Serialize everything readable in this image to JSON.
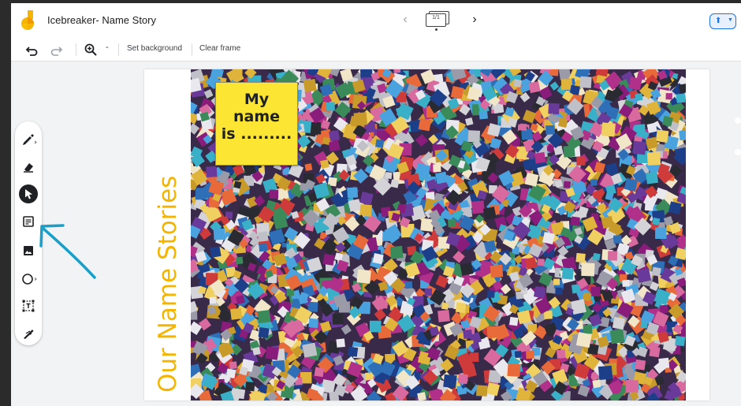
{
  "header": {
    "title": "Icebreaker- Name Story",
    "frame_counter": "1/1",
    "prev_icon": "chevron-left-icon",
    "next_icon": "chevron-right-icon",
    "share_icon": "present-icon"
  },
  "toolbar": {
    "undo_icon": "undo-icon",
    "redo_icon": "redo-icon",
    "zoom_icon": "zoom-icon",
    "zoom_minus": "-",
    "set_background": "Set background",
    "clear_frame": "Clear frame"
  },
  "tools": [
    {
      "name": "pen-icon"
    },
    {
      "name": "eraser-icon"
    },
    {
      "name": "select-icon",
      "active": true
    },
    {
      "name": "sticky-note-icon"
    },
    {
      "name": "image-icon"
    },
    {
      "name": "circle-icon"
    },
    {
      "name": "text-box-icon"
    },
    {
      "name": "laser-icon"
    }
  ],
  "frame": {
    "vertical_title": "Our Name Stories",
    "sticky_lines": [
      "My",
      "name",
      "is ........."
    ]
  },
  "colors": {
    "title_yellow": "#f4b400",
    "sticky_yellow": "#fde533",
    "annotation_arrow": "#1aa0c8",
    "accent_blue": "#1a73e8"
  }
}
